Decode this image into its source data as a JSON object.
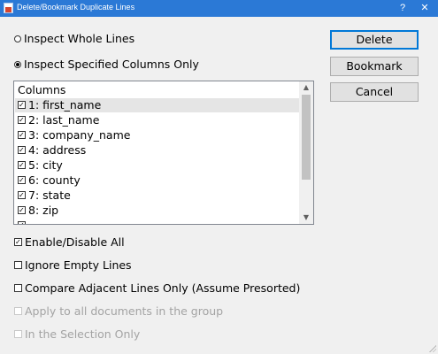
{
  "window": {
    "title": "Delete/Bookmark Duplicate Lines",
    "help_label": "?",
    "close_label": "✕"
  },
  "options": {
    "inspect_whole": "Inspect Whole Lines",
    "inspect_columns": "Inspect Specified Columns Only",
    "selected_mode": "inspect_columns"
  },
  "columns": {
    "header": "Columns",
    "items": [
      {
        "label": "1: first_name",
        "checked": true
      },
      {
        "label": "2: last_name",
        "checked": true
      },
      {
        "label": "3: company_name",
        "checked": true
      },
      {
        "label": "4: address",
        "checked": true
      },
      {
        "label": "5: city",
        "checked": true
      },
      {
        "label": "6: county",
        "checked": true
      },
      {
        "label": "7: state",
        "checked": true
      },
      {
        "label": "8: zip",
        "checked": true
      }
    ]
  },
  "checks": {
    "enable_all": "Enable/Disable All",
    "ignore_empty": "Ignore Empty Lines",
    "compare_adjacent": "Compare Adjacent Lines Only (Assume Presorted)",
    "apply_all_docs": "Apply to all documents in the group",
    "selection_only": "In the Selection Only"
  },
  "buttons": {
    "delete": "Delete",
    "bookmark": "Bookmark",
    "cancel": "Cancel"
  }
}
